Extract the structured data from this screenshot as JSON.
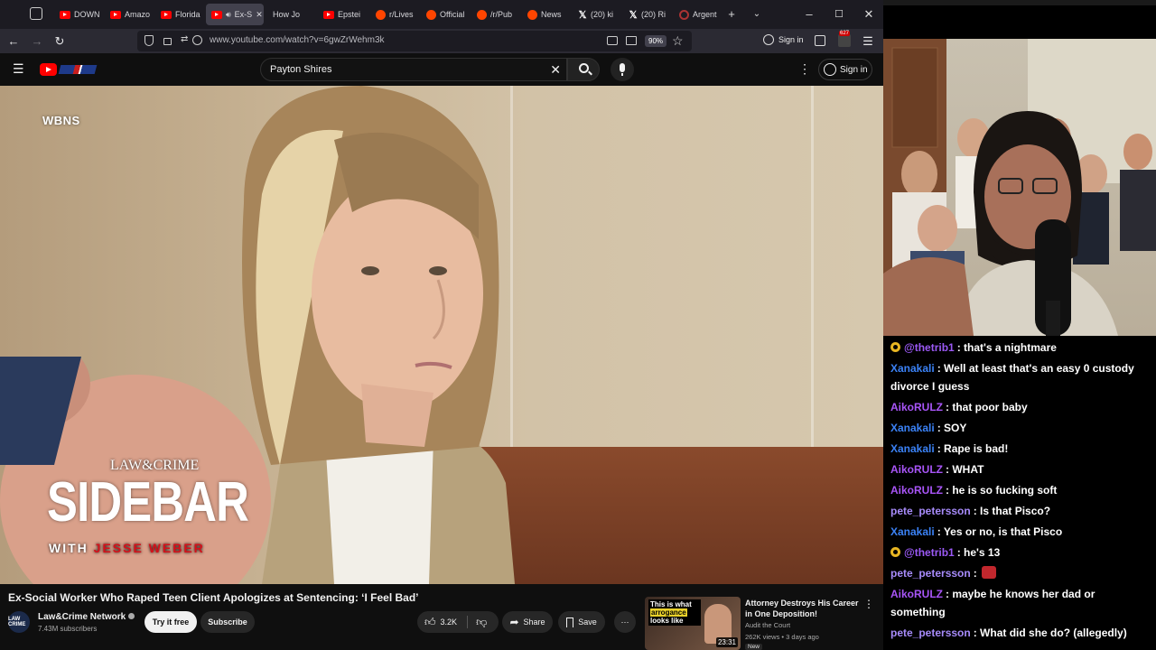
{
  "browser": {
    "tabs": [
      {
        "icon": "youtube",
        "label": "DOWN"
      },
      {
        "icon": "youtube",
        "label": "Amazo"
      },
      {
        "icon": "youtube",
        "label": "Florida"
      },
      {
        "icon": "youtube",
        "label": "Ex-S",
        "active": true
      },
      {
        "icon": "none",
        "label": "How Jo"
      },
      {
        "icon": "youtube",
        "label": "Epstei"
      },
      {
        "icon": "reddit",
        "label": "r/Lives"
      },
      {
        "icon": "reddit",
        "label": "Official"
      },
      {
        "icon": "reddit",
        "label": "/r/Pub"
      },
      {
        "icon": "reddit",
        "label": "News"
      },
      {
        "icon": "x",
        "label": "(20) ki"
      },
      {
        "icon": "x",
        "label": "(20) Ri"
      },
      {
        "icon": "argentina",
        "label": "Argent"
      }
    ],
    "url": "www.youtube.com/watch?v=6gwZrWehm3k",
    "zoom": "90%",
    "signin_label": "Sign in",
    "extension_badge": "627"
  },
  "youtube": {
    "search_query": "Payton Shires",
    "signin_label": "Sign in",
    "video": {
      "watermark": "WBNS",
      "show_logo": "LAW&CRIME",
      "show_title": "SIDEBAR",
      "show_sub_prefix": "WITH ",
      "show_sub_name": "JESSE WEBER"
    },
    "title": "Ex-Social Worker Who Raped Teen Client Apologizes at Sentencing: ‘I Feel Bad’",
    "channel": {
      "avatar_text": "LAW CRIME",
      "name": "Law&Crime Network",
      "subscribers": "7.43M subscribers"
    },
    "actions": {
      "try_label": "Try it free",
      "subscribe_label": "Subscribe",
      "likes": "3.2K",
      "share_label": "Share",
      "save_label": "Save"
    },
    "recommended": {
      "thumb_text_1": "This is what",
      "thumb_text_highlight": "arrogance",
      "thumb_text_2": "looks like",
      "duration": "23:31",
      "title": "Attorney Destroys His Career in One Deposition!",
      "channel": "Audit the Court",
      "meta": "262K views • 3 days ago",
      "badge": "New"
    }
  },
  "chat": {
    "messages": [
      {
        "user": "@thetrib1",
        "color": "#9b59f5",
        "badge": true,
        "text": ": that's a nightmare"
      },
      {
        "user": "Xanakali",
        "color": "#3b82f6",
        "text": ": Well at least that's an easy 0 custody divorce I guess"
      },
      {
        "user": "AikoRULZ",
        "color": "#a855f7",
        "text": ": that poor baby"
      },
      {
        "user": "Xanakali",
        "color": "#3b82f6",
        "text": ": SOY"
      },
      {
        "user": "Xanakali",
        "color": "#3b82f6",
        "text": ": Rape is bad!"
      },
      {
        "user": "AikoRULZ",
        "color": "#a855f7",
        "text": ": WHAT"
      },
      {
        "user": "AikoRULZ",
        "color": "#a855f7",
        "text": ": he is so fucking soft"
      },
      {
        "user": "pete_petersson",
        "color": "#a78bfa",
        "text": ": Is that Pisco?"
      },
      {
        "user": "Xanakali",
        "color": "#3b82f6",
        "text": ": Yes or no, is that Pisco"
      },
      {
        "user": "@thetrib1",
        "color": "#9b59f5",
        "badge": true,
        "text": ": he's 13"
      },
      {
        "user": "pete_petersson",
        "color": "#a78bfa",
        "emote": true,
        "text": ":"
      },
      {
        "user": "AikoRULZ",
        "color": "#a855f7",
        "text": ": maybe he knows her dad or something"
      },
      {
        "user": "pete_petersson",
        "color": "#a78bfa",
        "text": ": What did she do? (allegedly)"
      }
    ]
  }
}
